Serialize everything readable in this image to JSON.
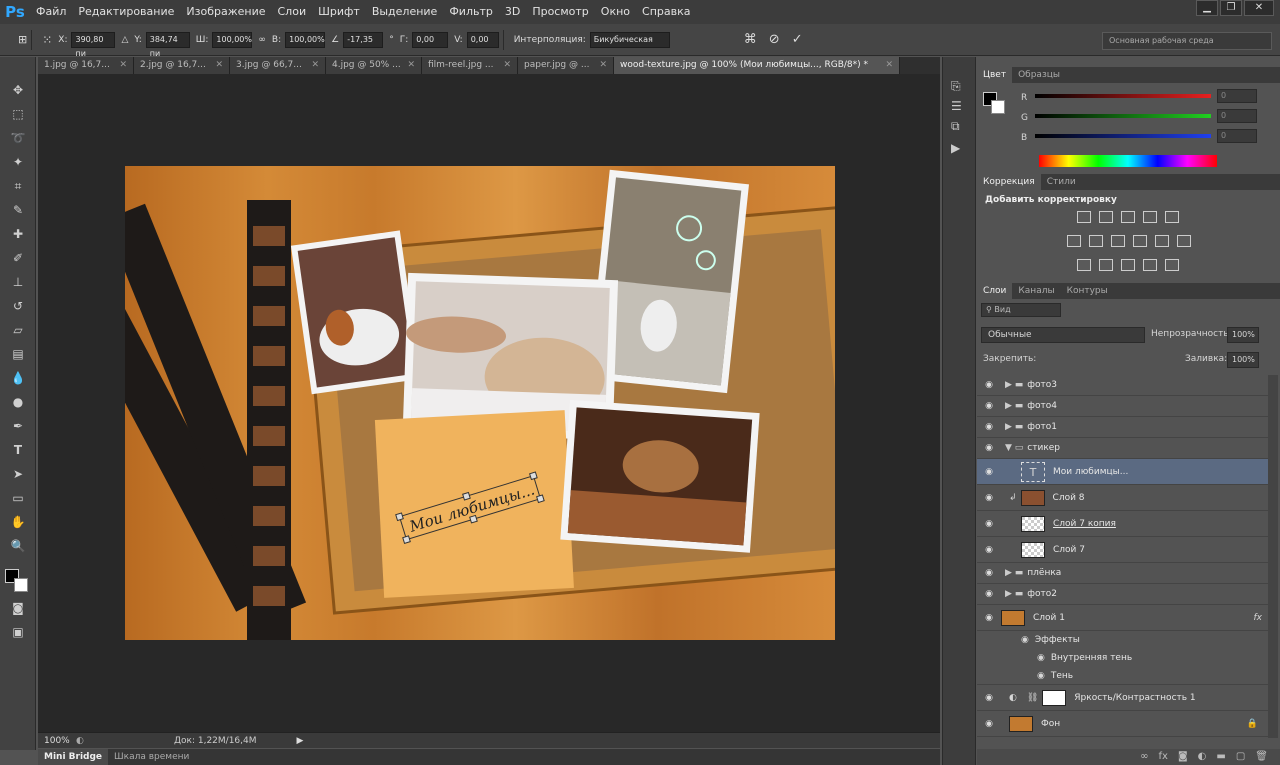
{
  "app": {
    "logo": "Ps"
  },
  "menu": [
    "Файл",
    "Редактирование",
    "Изображение",
    "Слои",
    "Шрифт",
    "Выделение",
    "Фильтр",
    "3D",
    "Просмотр",
    "Окно",
    "Справка"
  ],
  "options": {
    "x_label": "X:",
    "x_val": "390,80 пи",
    "y_label": "Y:",
    "y_val": "384,74 пи",
    "w_label": "Ш:",
    "w_val": "100,00%",
    "h_label": "В:",
    "h_val": "100,00%",
    "angle_label": "∠",
    "angle_val": "-17,35",
    "angle_unit": "°",
    "g_label": "Г:",
    "g_val": "0,00",
    "v_label": "V:",
    "v_val": "0,00",
    "interp_label": "Интерполяция:",
    "interp_val": "Бикубическая"
  },
  "workspace": "Основная рабочая среда",
  "tabs": [
    "1.jpg @ 16,7...",
    "2.jpg @ 16,7...",
    "3.jpg @ 66,7...",
    "4.jpg @ 50% ...",
    "film-reel.jpg ...",
    "paper.jpg @ ...",
    "wood-texture.jpg @ 100% (Мои любимцы..., RGB/8*) *"
  ],
  "canvas": {
    "caption": "Мои любимцы..."
  },
  "status": {
    "zoom": "100%",
    "doc": "Док: 1,22M/16,4M"
  },
  "bottom_tabs": [
    "Mini Bridge",
    "Шкала времени"
  ],
  "color_panel": {
    "tabs": [
      "Цвет",
      "Образцы"
    ],
    "channels": [
      {
        "label": "R",
        "value": "0",
        "color": "#c82424"
      },
      {
        "label": "G",
        "value": "0",
        "color": "#22a422"
      },
      {
        "label": "B",
        "value": "0",
        "color": "#2438c8"
      }
    ]
  },
  "adjust_panel": {
    "tabs": [
      "Коррекция",
      "Стили"
    ],
    "title": "Добавить корректировку"
  },
  "layers_panel": {
    "tabs": [
      "Слои",
      "Каналы",
      "Контуры"
    ],
    "filter": "Вид",
    "blend": "Обычные",
    "opacity_label": "Непрозрачность:",
    "opacity": "100%",
    "lock_label": "Закрепить:",
    "fill_label": "Заливка:",
    "fill": "100%",
    "layers": [
      {
        "name": "фото3",
        "type": "folder"
      },
      {
        "name": "фото4",
        "type": "folder"
      },
      {
        "name": "фото1",
        "type": "folder"
      },
      {
        "name": "стикер",
        "type": "folder-open"
      },
      {
        "name": "Мои любимцы...",
        "type": "text",
        "selected": true
      },
      {
        "name": "Слой 8",
        "type": "image"
      },
      {
        "name": "Слой 7 копия",
        "type": "image"
      },
      {
        "name": "Слой 7",
        "type": "image"
      },
      {
        "name": "плёнка",
        "type": "folder"
      },
      {
        "name": "фото2",
        "type": "folder"
      },
      {
        "name": "Слой 1",
        "type": "image",
        "fx": "fx"
      },
      {
        "name": "Эффекты",
        "type": "effects"
      },
      {
        "name": "Внутренняя тень",
        "type": "effect"
      },
      {
        "name": "Тень",
        "type": "effect"
      },
      {
        "name": "Яркость/Контрастность 1",
        "type": "adjust"
      },
      {
        "name": "Фон",
        "type": "bg"
      }
    ]
  }
}
